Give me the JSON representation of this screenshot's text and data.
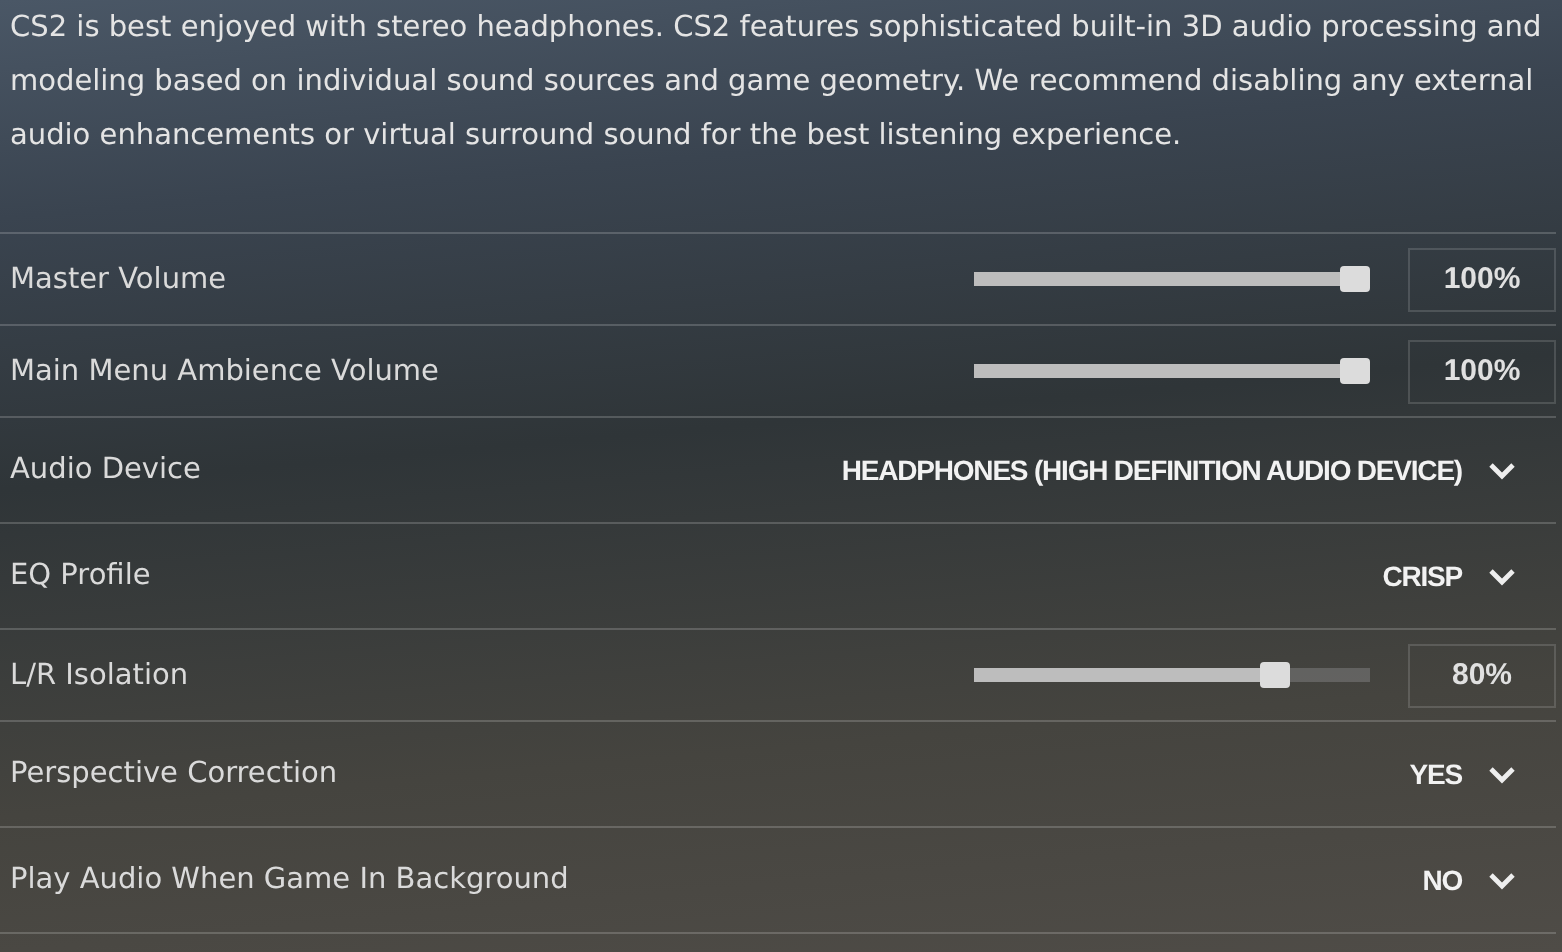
{
  "intro": "CS2 is best enjoyed with stereo headphones. CS2 features sophisticated built-in 3D audio processing and modeling based on individual sound sources and game geometry. We recommend disabling any external audio enhancements or virtual surround sound for the best listening experience.",
  "settings": [
    {
      "kind": "slider",
      "label": "Master Volume",
      "level": 1.0,
      "value": "100%"
    },
    {
      "kind": "slider",
      "label": "Main Menu Ambience Volume",
      "level": 1.0,
      "value": "100%"
    },
    {
      "kind": "dropdown",
      "label": "Audio Device",
      "value": "HEADPHONES (HIGH DEFINITION AUDIO DEVICE)"
    },
    {
      "kind": "dropdown",
      "label": "EQ Profile",
      "value": "CRISP"
    },
    {
      "kind": "slider",
      "label": "L/R Isolation",
      "level": 0.8,
      "value": "80%"
    },
    {
      "kind": "dropdown",
      "label": "Perspective Correction",
      "value": "YES"
    },
    {
      "kind": "dropdown",
      "label": "Play Audio When Game In Background",
      "value": "NO"
    }
  ]
}
